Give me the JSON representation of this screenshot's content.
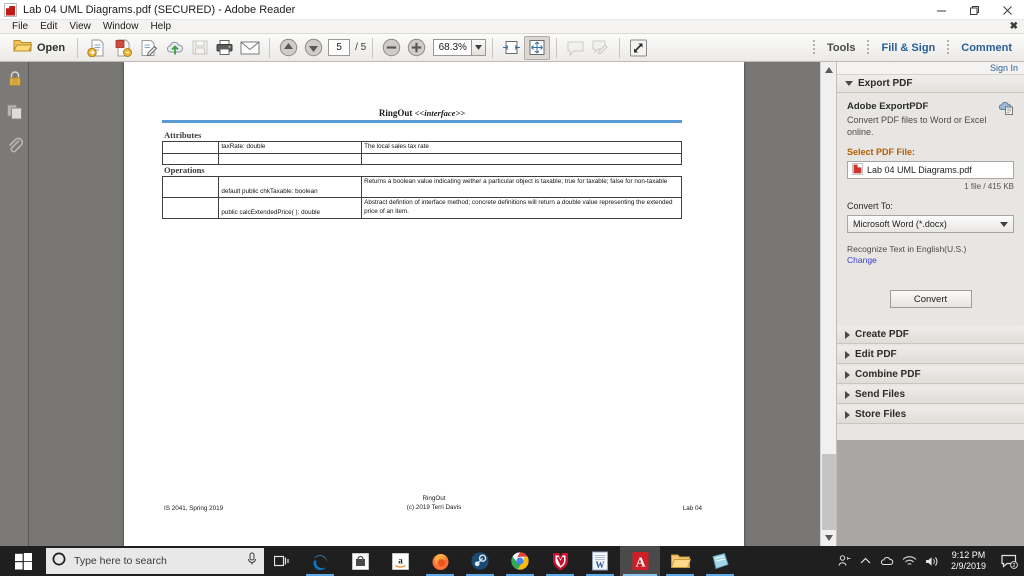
{
  "window": {
    "title": "Lab 04 UML Diagrams.pdf (SECURED) - Adobe Reader",
    "app_icon": "pdf-file-icon",
    "minimize": "–",
    "restore": "❐",
    "close": "✕"
  },
  "menubar": {
    "items": [
      {
        "label": "File"
      },
      {
        "label": "Edit"
      },
      {
        "label": "View"
      },
      {
        "label": "Window"
      },
      {
        "label": "Help"
      }
    ],
    "close_doc": "✖"
  },
  "toolbar": {
    "open_label": "Open",
    "page_current": "5",
    "page_total": "/ 5",
    "zoom_value": "68.3%",
    "icons": [
      "folder-open-icon",
      "create-pdf-icon",
      "export-pdf-icon",
      "edit-pdf-icon",
      "store-cloud-icon",
      "save-icon",
      "print-icon",
      "email-icon",
      "previous-page-icon",
      "next-page-icon",
      "zoom-out-icon",
      "zoom-in-icon",
      "zoom-dropdown-icon",
      "fit-width-icon",
      "fit-page-icon",
      "sticky-note-icon",
      "highlight-text-icon",
      "fullscreen-icon"
    ],
    "tools": "Tools",
    "fill_sign": "Fill & Sign",
    "comment": "Comment"
  },
  "leftrail": {
    "items": [
      {
        "name": "security-lock-icon",
        "label": "Security Settings"
      },
      {
        "name": "page-thumbnails-icon",
        "label": "Page Thumbnails"
      },
      {
        "name": "attachments-paperclip-icon",
        "label": "Attachments"
      }
    ]
  },
  "document": {
    "uml_title": "RingOut",
    "uml_stereotype": "<<interface>>",
    "attributes_heading": "Attributes",
    "operations_heading": "Operations",
    "attributes_rows": [
      {
        "visibility": "",
        "member": "taxRate: double",
        "description": "The local sales tax rate"
      },
      {
        "visibility": "",
        "member": "",
        "description": ""
      }
    ],
    "operations_rows": [
      {
        "visibility": "",
        "member": "default public chkTaxable: boolean",
        "description": "Returns a boolean value indicating wether a particular object is taxable; true for taxable; false for non-taxable"
      },
      {
        "visibility": "",
        "member": "public calcExtendedPrice( ): double",
        "description": "Abstract defintion of interface method; concrete definitions will return a double value representing the extended price of an item."
      }
    ],
    "footer_left": "IS 2041, Spring 2019",
    "footer_center_line1": "RingOut",
    "footer_center_line2": "(c) 2019 Terri Davis",
    "footer_right": "Lab 04"
  },
  "rightpanel": {
    "sign_in": "Sign In",
    "export": {
      "header": "Export PDF",
      "product_title": "Adobe ExportPDF",
      "description": "Convert PDF files to Word or Excel online.",
      "select_label": "Select PDF File:",
      "selected_file": "Lab 04 UML Diagrams.pdf",
      "file_info": "1 file / 415 KB",
      "convert_to_label": "Convert To:",
      "convert_to_value": "Microsoft Word (*.docx)",
      "ocr_text": "Recognize Text in English(U.S.)",
      "change_link": "Change",
      "convert_button": "Convert"
    },
    "sections": [
      {
        "label": "Create PDF"
      },
      {
        "label": "Edit PDF"
      },
      {
        "label": "Combine PDF"
      },
      {
        "label": "Send Files"
      },
      {
        "label": "Store Files"
      }
    ]
  },
  "taskbar": {
    "start_icon": "windows-start-icon",
    "search_placeholder": "Type here to search",
    "search_icons": [
      "cortana-circle-icon",
      "microphone-icon"
    ],
    "task_view": "task-view-icon",
    "apps": [
      {
        "name": "edge-icon",
        "label": "Microsoft Edge",
        "state": "open"
      },
      {
        "name": "microsoft-store-icon",
        "label": "Microsoft Store",
        "state": "closed"
      },
      {
        "name": "amazon-icon",
        "label": "Amazon",
        "state": "closed"
      },
      {
        "name": "firefox-icon",
        "label": "Mozilla Firefox",
        "state": "open"
      },
      {
        "name": "steam-icon",
        "label": "Steam",
        "state": "open"
      },
      {
        "name": "chrome-icon",
        "label": "Google Chrome",
        "state": "open"
      },
      {
        "name": "mcafee-icon",
        "label": "McAfee",
        "state": "open"
      },
      {
        "name": "word-icon",
        "label": "Microsoft Word",
        "state": "open"
      },
      {
        "name": "adobe-reader-icon",
        "label": "Adobe Reader",
        "state": "active"
      },
      {
        "name": "file-explorer-icon",
        "label": "File Explorer",
        "state": "open"
      },
      {
        "name": "sticky-notes-icon",
        "label": "Sticky Notes",
        "state": "open"
      }
    ],
    "tray": {
      "icons": [
        "people-icon",
        "show-hidden-icons-chevron",
        "onedrive-icon",
        "network-wifi-icon",
        "volume-icon"
      ],
      "time": "9:12 PM",
      "date": "2/9/2019",
      "notifications_icon": "action-center-icon",
      "notifications_count": "2"
    }
  },
  "colors": {
    "accent_blue": "#2a6099",
    "title_rule": "#5b9bd5",
    "orange_label": "#b35c00",
    "link_purple": "#3a3ad0",
    "taskbar": "#1f1f1f",
    "doc_background": "#797774"
  }
}
